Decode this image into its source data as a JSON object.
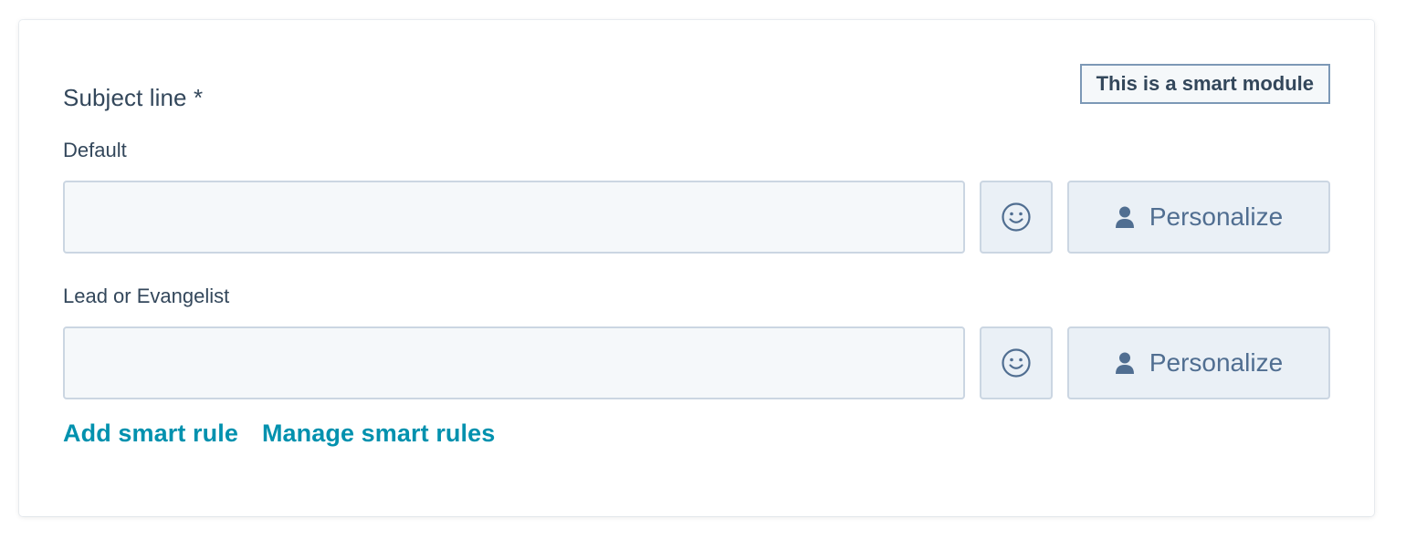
{
  "section": {
    "title": "Subject line *",
    "badge": "This is a smart module"
  },
  "fields": [
    {
      "label": "Default",
      "value": "",
      "placeholder": "",
      "emoji_icon": "smiley-face-icon",
      "personalize_icon": "contact-person-icon",
      "personalize_label": "Personalize"
    },
    {
      "label": "Lead or Evangelist",
      "value": "",
      "placeholder": "",
      "emoji_icon": "smiley-face-icon",
      "personalize_icon": "contact-person-icon",
      "personalize_label": "Personalize"
    }
  ],
  "actions": {
    "add_smart_rule": "Add smart rule",
    "manage_smart_rules": "Manage smart rules"
  },
  "colors": {
    "text": "#33475b",
    "link": "#0091ae",
    "input_bg": "#f5f8fa",
    "input_border": "#cbd6e2",
    "button_bg": "#eaf0f6",
    "icon": "#506e91"
  }
}
